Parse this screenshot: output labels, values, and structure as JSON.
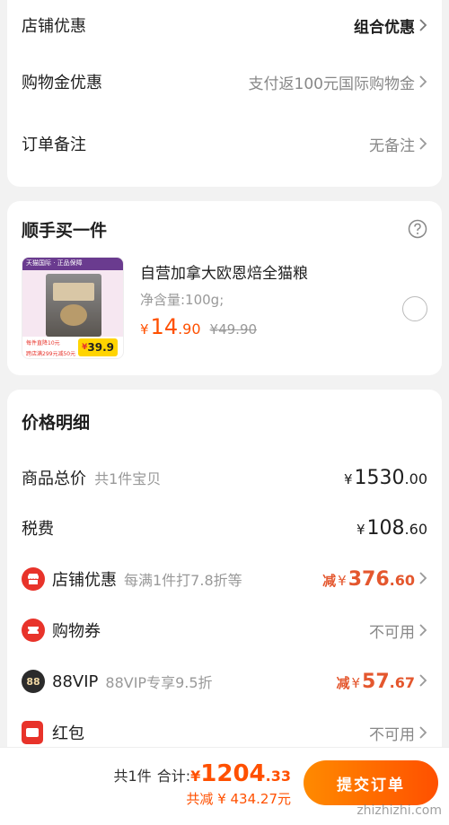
{
  "order_options": {
    "shop_discount": {
      "label": "店铺优惠",
      "value": "组合优惠"
    },
    "global_coupon": {
      "label": "购物金优惠",
      "value": "支付返100元国际购物金"
    },
    "order_note": {
      "label": "订单备注",
      "value": "无备注"
    }
  },
  "add_on": {
    "title": "顺手买一件",
    "product": {
      "name": "自营加拿大欧恩焙全猫粮",
      "spec": "净含量:100g;",
      "currency": "¥",
      "price_int": "14",
      "price_dec": ".90",
      "original_price": "¥49.90",
      "image_tag_top": "天猫国际 · 正品保障",
      "image_tag_price": "39.9",
      "image_tag_line1": "每件直降10元",
      "image_tag_line2": "跨店满299元减50元"
    }
  },
  "price_detail": {
    "title": "价格明细",
    "goods_total": {
      "label": "商品总价",
      "sub": "共1件宝贝",
      "currency": "¥",
      "int": "1530",
      "dec": ".00"
    },
    "tax": {
      "label": "税费",
      "currency": "¥",
      "int": "108",
      "dec": ".60"
    },
    "shop_discount": {
      "label": "店铺优惠",
      "sub": "每满1件打7.8折等",
      "prefix": "减",
      "currency": "¥",
      "int": "376",
      "dec": ".60"
    },
    "voucher": {
      "label": "购物券",
      "value": "不可用"
    },
    "vip": {
      "label": "88VIP",
      "badge": "88",
      "sub": "88VIP专享9.5折",
      "prefix": "减",
      "currency": "¥",
      "int": "57",
      "dec": ".67"
    },
    "red_packet": {
      "label": "红包",
      "value": "不可用"
    }
  },
  "bottom_bar": {
    "count": "共1件",
    "total_label": "合计:",
    "currency": "¥",
    "total_int": "1204",
    "total_dec": ".33",
    "saving": "共减 ¥ 434.27元",
    "submit": "提交订单"
  },
  "watermark": "zhizhizhi.com",
  "colors": {
    "accent": "#ff5000",
    "red_icon": "#e8332a",
    "background": "#f2f2f2"
  }
}
